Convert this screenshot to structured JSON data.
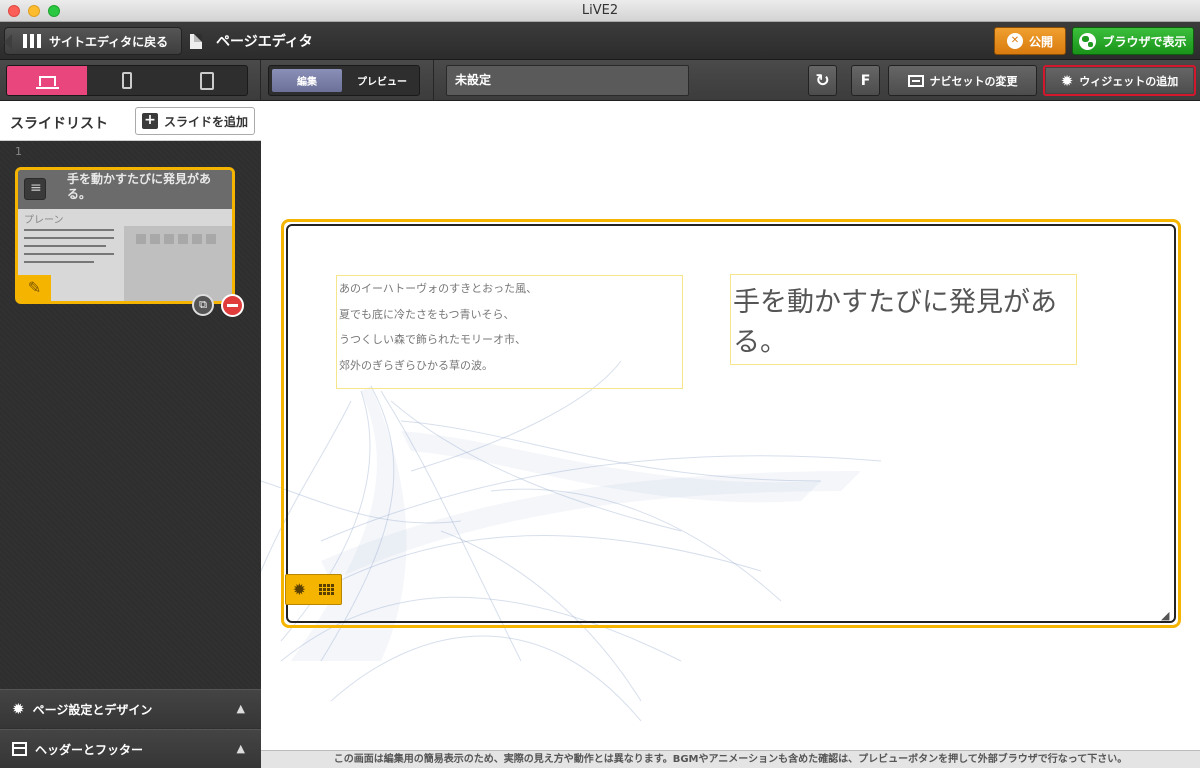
{
  "window": {
    "title": "LiVE2"
  },
  "toolbar": {
    "back_label": "サイトエディタに戻る",
    "page_title": "ページエディタ",
    "publish_label": "公開",
    "browser_label": "ブラウザで表示"
  },
  "subtoolbar": {
    "mode_edit": "編集",
    "mode_preview": "プレビュー",
    "navigation_value": "未設定",
    "f_label": "F",
    "naviset_label": "ナビセットの変更",
    "add_widget_label": "ウィジェットの追加",
    "refresh_glyph": "↻"
  },
  "sidebar": {
    "slide_list_title": "スライドリスト",
    "add_slide_label": "スライドを追加",
    "slides": [
      {
        "number": "1",
        "title": "手を動かすたびに発見がある。",
        "layout": "プレーン"
      }
    ],
    "accordion": [
      {
        "label": "ページ設定とデザイン"
      },
      {
        "label": "ヘッダーとフッター"
      }
    ]
  },
  "canvas": {
    "body_lines": [
      "あのイーハトーヴォのすきとおった風、",
      "夏でも底に冷たさをもつ青いそら、",
      "うつくしい森で飾られたモリーオ市、",
      "郊外のぎらぎらひかる草の波。"
    ],
    "heading": "手を動かすたびに発見がある。"
  },
  "footer_note": "この画面は編集用の簡易表示のため、実際の見え方や動作とは異なります。BGMやアニメーションも含めた確認は、プレビューボタンを押して外部ブラウザで行なって下さい。",
  "colors": {
    "accent_pink": "#e8467c",
    "highlight_yellow": "#f4b400",
    "publish_orange": "#e08a1a",
    "browser_green": "#27a827",
    "widget_button_border": "#d3182e"
  }
}
